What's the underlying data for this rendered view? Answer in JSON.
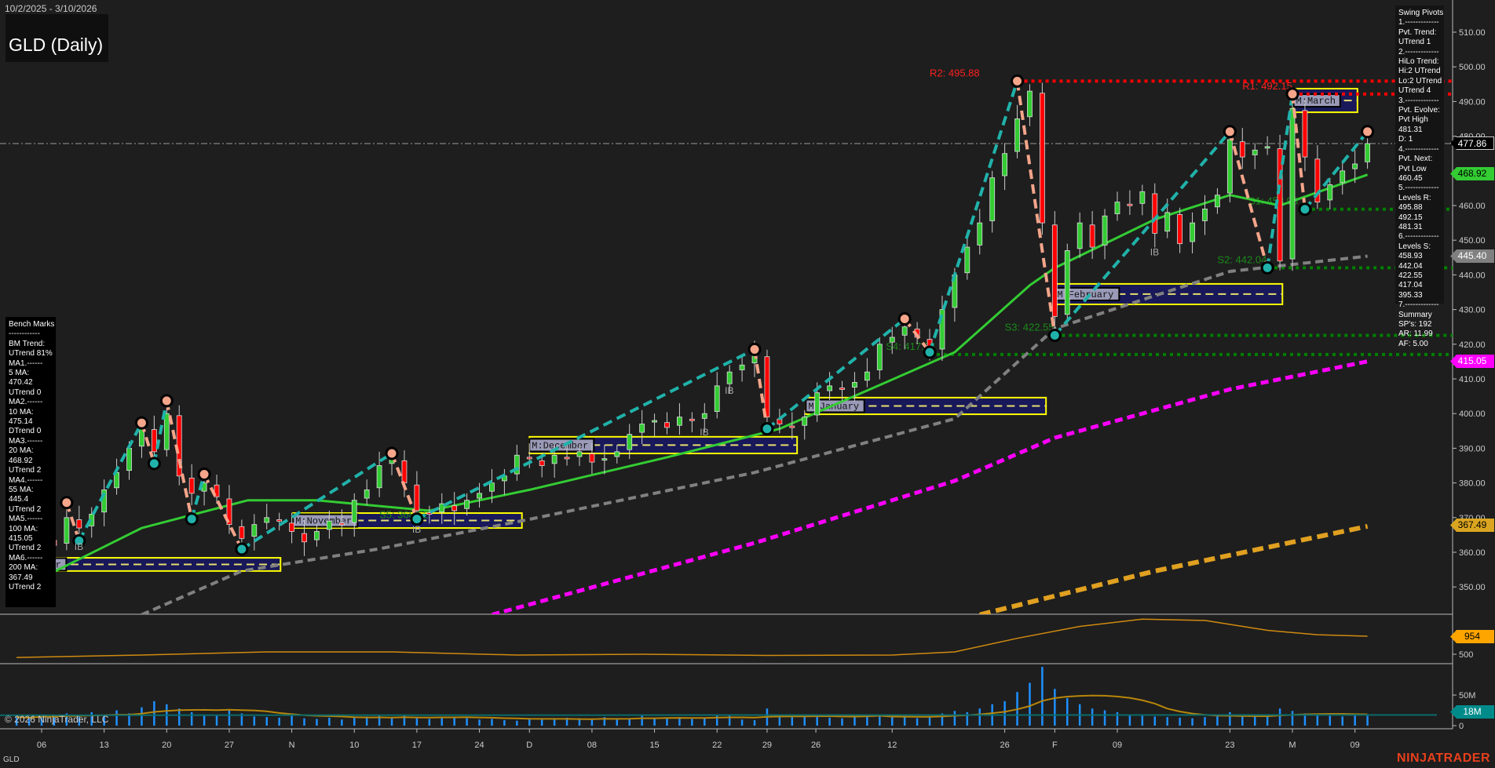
{
  "header": {
    "date_range": "10/2/2025 - 3/10/2026",
    "title": "GLD (Daily)"
  },
  "swing_pivots": {
    "lines": [
      "Swing Pivots",
      "1.-------------",
      "Pvt. Trend:",
      "UTrend 1",
      "2.-------------",
      "HiLo Trend:",
      "Hi:2 UTrend",
      "Lo:2 UTrend",
      "UTrend 4",
      "3.-------------",
      "Pvt. Evolve:",
      "Pvt High",
      "481.31",
      "D: 1",
      "4.-------------",
      "Pvt. Next:",
      "Pvt Low",
      "460.45",
      "5.-------------",
      "Levels R:",
      "495.88",
      "492.15",
      "481.31",
      "6.-------------",
      "Levels S:",
      "458.93",
      "442.04",
      "422.55",
      "417.04",
      "395.33",
      "7.-------------",
      "Summary",
      "SP's: 192",
      "AR: 11.99",
      "AF: 5.00"
    ]
  },
  "bench_marks": {
    "lines": [
      "Bench Marks",
      "------------",
      "BM Trend:",
      "UTrend 81%",
      "MA1.------",
      "5 MA:",
      "470.42",
      "UTrend 0",
      "MA2.------",
      "10 MA:",
      "475.14",
      "DTrend 0",
      "MA3.------",
      "20 MA:",
      "468.92",
      "UTrend 2",
      "MA4.------",
      "55 MA:",
      "445.4",
      "UTrend 2",
      "MA5.------",
      "100 MA:",
      "415.05",
      "UTrend 2",
      "MA6.------",
      "200 MA:",
      "367.49",
      "UTrend 2"
    ]
  },
  "footer": {
    "copyright": "© 2026 NinjaTrader, LLC",
    "symbol": "GLD",
    "brand": "NINJATRADER"
  },
  "price_tags": {
    "last": "477.86",
    "ma20": "468.92",
    "ma55": "445.40",
    "ma100": "415.05",
    "ma200": "367.49",
    "osc": "954",
    "volume": "18M"
  },
  "colors": {
    "background": "#1e1e1e",
    "up": "#33cc33",
    "down": "#ff0000",
    "up_leg": "#20b2aa",
    "down_leg": "#f4a58a",
    "ma20": "#33cc33",
    "ma55": "#808080",
    "ma100": "#ff00ff",
    "ma200": "#e0a020",
    "volume": "#1e90ff",
    "resistance": "#ff0000",
    "support": "#008000",
    "month_box": "#ffff00"
  },
  "chart_data": {
    "type": "candlestick",
    "y_axis": {
      "min": 340,
      "max": 515,
      "ticks": [
        "510.00",
        "500.00",
        "490.00",
        "480.00",
        "470.00",
        "460.00",
        "450.00",
        "440.00",
        "430.00",
        "420.00",
        "410.00",
        "400.00",
        "390.00",
        "380.00",
        "370.00",
        "360.00",
        "350.00"
      ]
    },
    "x_axis": {
      "labels": [
        [
          "06",
          2
        ],
        [
          "13",
          7
        ],
        [
          "20",
          12
        ],
        [
          "27",
          17
        ],
        [
          "N",
          22
        ],
        [
          "10",
          27
        ],
        [
          "17",
          32
        ],
        [
          "24",
          37
        ],
        [
          "D",
          41
        ],
        [
          "08",
          46
        ],
        [
          "15",
          51
        ],
        [
          "22",
          56
        ],
        [
          "29",
          60
        ],
        [
          "26",
          63.9
        ],
        [
          "12",
          70
        ],
        [
          "26",
          79
        ],
        [
          "F",
          83
        ],
        [
          "09",
          88
        ],
        [
          "23",
          97
        ],
        [
          "M",
          102
        ],
        [
          "09",
          107
        ]
      ]
    },
    "closes": [
      358,
      360,
      364,
      362,
      370,
      367,
      371,
      378,
      383,
      390,
      396,
      389,
      400,
      382,
      377,
      380,
      376,
      368,
      364,
      368,
      370,
      369,
      366,
      363,
      366,
      369,
      368,
      375,
      378,
      385,
      387,
      380,
      372,
      371,
      374,
      372,
      375,
      377,
      380,
      382,
      388,
      387,
      385,
      388,
      387,
      389,
      386,
      387,
      389,
      394,
      397,
      398,
      396,
      399,
      398,
      400,
      408,
      412,
      414,
      417,
      399,
      397,
      396,
      399,
      406,
      408,
      407,
      409,
      412,
      420,
      422,
      425,
      422,
      418,
      430,
      440,
      448,
      455,
      468,
      475,
      485,
      493,
      455,
      428,
      447,
      455,
      448,
      457,
      461,
      460,
      464,
      452,
      458,
      449,
      455,
      459,
      463,
      479,
      474,
      476,
      477,
      444,
      488,
      474,
      461,
      466,
      470,
      472,
      477.86
    ],
    "volumes_m": [
      14,
      12,
      18,
      15,
      20,
      16,
      22,
      18,
      25,
      20,
      30,
      40,
      35,
      28,
      22,
      18,
      16,
      25,
      20,
      15,
      14,
      13,
      16,
      12,
      11,
      13,
      10,
      14,
      15,
      16,
      12,
      18,
      12,
      11,
      13,
      14,
      12,
      10,
      11,
      9,
      8,
      12,
      10,
      11,
      13,
      12,
      11,
      14,
      10,
      12,
      16,
      12,
      13,
      14,
      11,
      12,
      18,
      16,
      10,
      9,
      28,
      18,
      14,
      15,
      14,
      13,
      12,
      14,
      16,
      18,
      14,
      16,
      12,
      15,
      20,
      24,
      22,
      28,
      35,
      40,
      55,
      70,
      96,
      60,
      45,
      35,
      28,
      25,
      22,
      18,
      16,
      15,
      14,
      13,
      12,
      14,
      15,
      22,
      18,
      16,
      15,
      28,
      24,
      20,
      18,
      16,
      15,
      17,
      16
    ],
    "moving_averages": [
      {
        "name": "20 MA",
        "style": "solid",
        "points": [
          [
            0,
            349
          ],
          [
            10,
            367
          ],
          [
            18.5,
            375
          ],
          [
            24,
            375
          ],
          [
            33,
            372
          ],
          [
            41,
            378
          ],
          [
            52,
            387.4
          ],
          [
            61,
            395.6
          ],
          [
            75,
            417.7
          ],
          [
            81,
            437
          ],
          [
            83,
            442
          ],
          [
            91,
            456
          ],
          [
            97,
            463
          ],
          [
            101,
            460
          ],
          [
            108,
            468.9
          ]
        ]
      },
      {
        "name": "55 MA",
        "style": "dashed",
        "points": [
          [
            10,
            342
          ],
          [
            18,
            354.6
          ],
          [
            29,
            361
          ],
          [
            41,
            369.5
          ],
          [
            59,
            383
          ],
          [
            75,
            398.5
          ],
          [
            83,
            424.5
          ],
          [
            91,
            434
          ],
          [
            97,
            441
          ],
          [
            108,
            445.4
          ]
        ]
      },
      {
        "name": "100 MA",
        "style": "dashed",
        "points": [
          [
            38,
            342
          ],
          [
            59,
            362.7
          ],
          [
            75,
            380.6
          ],
          [
            83,
            393
          ],
          [
            97,
            407
          ],
          [
            108,
            415.05
          ]
        ]
      },
      {
        "name": "200 MA",
        "style": "dashed",
        "points": [
          [
            77,
            342
          ],
          [
            91,
            354.6
          ],
          [
            108,
            367.49
          ]
        ]
      }
    ],
    "swing_pivots": [
      [
        4,
        374.3,
        "H"
      ],
      [
        5,
        363.3,
        "L"
      ],
      [
        10,
        397.3,
        "H"
      ],
      [
        11,
        385.6,
        "L"
      ],
      [
        12,
        403.7,
        "H"
      ],
      [
        14,
        369.6,
        "L"
      ],
      [
        15,
        382.5,
        "H"
      ],
      [
        18,
        360.9,
        "L"
      ],
      [
        30,
        388.5,
        "H"
      ],
      [
        32,
        369.6,
        "L"
      ],
      [
        59,
        418.5,
        "H"
      ],
      [
        60,
        395.6,
        "L"
      ],
      [
        71,
        427.3,
        "H"
      ],
      [
        73,
        417.7,
        "L"
      ],
      [
        80,
        495.88,
        "H"
      ],
      [
        83,
        422.55,
        "L"
      ],
      [
        97,
        481.31,
        "H"
      ],
      [
        100,
        442.04,
        "L"
      ],
      [
        102,
        492.15,
        "H"
      ],
      [
        103,
        458.93,
        "L"
      ],
      [
        108,
        481.31,
        "H"
      ]
    ],
    "levels": [
      {
        "label": "R2: 495.88",
        "price": 495.88,
        "from": 80,
        "kind": "resistance",
        "label_at": 73
      },
      {
        "label": "R1: 492.15",
        "price": 492.15,
        "from": 102,
        "kind": "resistance",
        "label_at": 98
      },
      {
        "label": "S1: 458.93",
        "price": 458.93,
        "from": 103,
        "kind": "support",
        "label_at": 98.5
      },
      {
        "label": "S2: 442.04",
        "price": 442.04,
        "from": 100,
        "kind": "support",
        "label_at": 96
      },
      {
        "label": "S3: 422.55",
        "price": 422.55,
        "from": 83,
        "kind": "support",
        "label_at": 79
      },
      {
        "label": "S4: 417.04",
        "price": 417.04,
        "from": 73,
        "kind": "support",
        "label_at": 69.5
      },
      {
        "label": "S5: 368.52",
        "price": 368.52,
        "from": 30,
        "kind": "support_label",
        "label_at": 29
      }
    ],
    "month_ranges": [
      {
        "label": "M:October",
        "from": -0.7,
        "to": 21.1,
        "high": 358.4,
        "low": 354.6
      },
      {
        "label": "M:November",
        "from": 22.1,
        "to": 40.4,
        "high": 371.3,
        "low": 367
      },
      {
        "label": "M:December",
        "from": 41,
        "to": 62.4,
        "high": 393.3,
        "low": 388.5
      },
      {
        "label": "M:January",
        "from": 63.1,
        "to": 82.3,
        "high": 404.6,
        "low": 399.8
      },
      {
        "label": "M:February",
        "from": 83,
        "to": 101.2,
        "high": 437.4,
        "low": 431.5
      },
      {
        "label": "M:March",
        "from": 102.1,
        "to": 107.2,
        "high": 493.7,
        "low": 486.9
      }
    ],
    "ib_markers": [
      [
        5,
        "IB"
      ],
      [
        32,
        "IB"
      ],
      [
        55,
        "IB"
      ],
      [
        57,
        "IB"
      ],
      [
        91,
        "IB"
      ]
    ],
    "oscillator": {
      "points": [
        [
          0,
          420
        ],
        [
          10,
          480
        ],
        [
          20,
          560
        ],
        [
          30,
          560
        ],
        [
          40,
          480
        ],
        [
          50,
          500
        ],
        [
          60,
          470
        ],
        [
          70,
          480
        ],
        [
          75,
          560
        ],
        [
          80,
          900
        ],
        [
          85,
          1200
        ],
        [
          90,
          1380
        ],
        [
          95,
          1350
        ],
        [
          100,
          1100
        ],
        [
          104,
          990
        ],
        [
          108,
          954
        ]
      ],
      "tick": "500"
    },
    "volume_axis": {
      "ticks": [
        "50M",
        "0"
      ]
    }
  }
}
